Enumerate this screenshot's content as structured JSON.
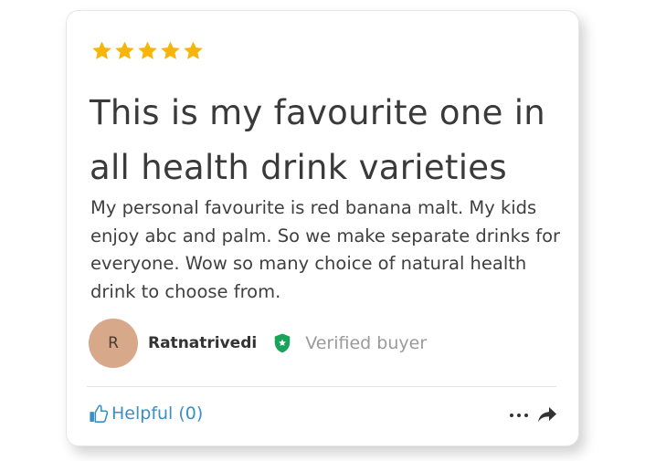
{
  "review": {
    "rating": 5,
    "rating_max": 5,
    "star_color": "#f5b50a",
    "title": "This is my favourite one in all health drink varieties",
    "body": "My personal favourite is red banana malt. My kids enjoy abc and palm. So we make separate drinks for everyone. Wow so many choice of natural health drink to choose from."
  },
  "reviewer": {
    "initial": "R",
    "name": "Ratnatrivedi",
    "verified_label": "Verified buyer",
    "avatar_color": "#d7a98a",
    "badge_color": "#1aa35a"
  },
  "actions": {
    "helpful_label": "Helpful",
    "helpful_count": "(0)",
    "helpful_icon": "thumbs-up-icon",
    "more_icon": "more-dots-icon",
    "share_icon": "share-arrow-icon",
    "link_color": "#3a8fc4"
  }
}
